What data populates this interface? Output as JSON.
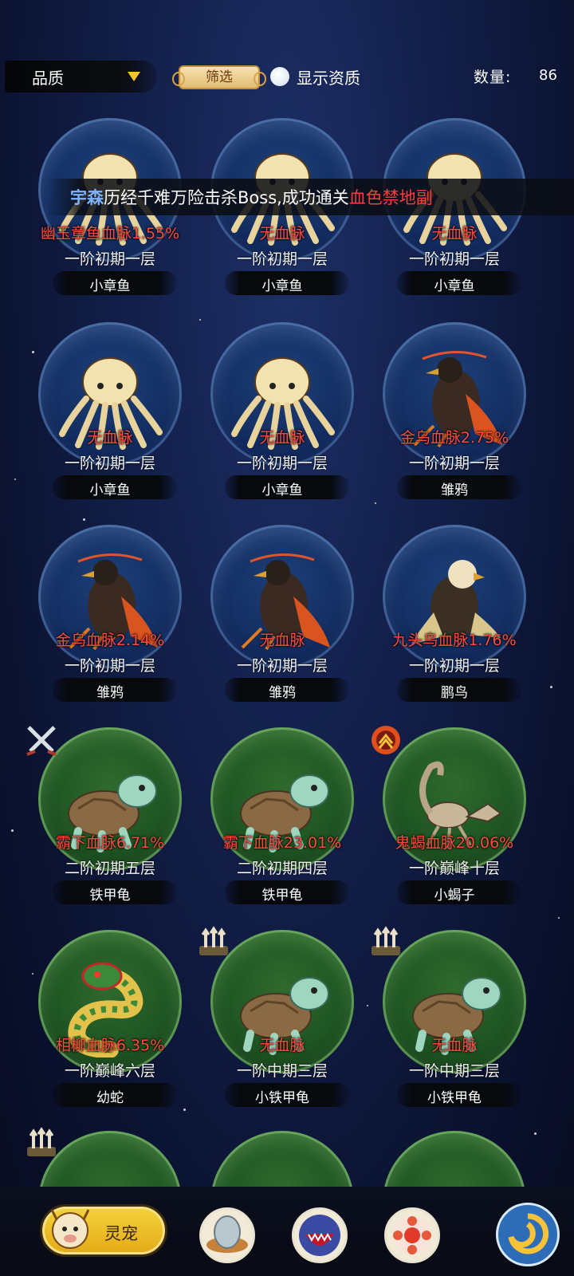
{
  "top_bar": {
    "quality_label": "品质",
    "filter_label": "筛选",
    "show_aptitude_label": "显示资质",
    "count_label": "数量:",
    "count_value": "86"
  },
  "broadcast": {
    "player": "宇森",
    "text": "历经千难万险击杀Boss,成功通关",
    "place": "血色禁地副"
  },
  "pets": [
    {
      "blood": "幽玉章鱼血脉1.55%",
      "stage": "一阶初期一层",
      "name": "小章鱼",
      "orb": "blue",
      "icon": "octopus-icon"
    },
    {
      "blood": "无血脉",
      "stage": "一阶初期一层",
      "name": "小章鱼",
      "orb": "blue",
      "icon": "octopus-icon"
    },
    {
      "blood": "无血脉",
      "stage": "一阶初期一层",
      "name": "小章鱼",
      "orb": "blue",
      "icon": "octopus-icon"
    },
    {
      "blood": "无血脉",
      "stage": "一阶初期一层",
      "name": "小章鱼",
      "orb": "blue",
      "icon": "octopus-icon"
    },
    {
      "blood": "无血脉",
      "stage": "一阶初期一层",
      "name": "小章鱼",
      "orb": "blue",
      "icon": "octopus-icon"
    },
    {
      "blood": "金乌血脉2.75%",
      "stage": "一阶初期一层",
      "name": "雏鸦",
      "orb": "blue",
      "icon": "crow-icon"
    },
    {
      "blood": "金乌血脉2.14%",
      "stage": "一阶初期一层",
      "name": "雏鸦",
      "orb": "blue",
      "icon": "crow-icon"
    },
    {
      "blood": "无血脉",
      "stage": "一阶初期一层",
      "name": "雏鸦",
      "orb": "blue",
      "icon": "crow-icon"
    },
    {
      "blood": "九头鸟血脉1.76%",
      "stage": "一阶初期一层",
      "name": "鹏鸟",
      "orb": "blue",
      "icon": "eagle-icon"
    },
    {
      "blood": "霸下血脉6.71%",
      "stage": "二阶初期五层",
      "name": "铁甲龟",
      "orb": "green",
      "icon": "turtle-icon",
      "badge": "crossed-swords-badge"
    },
    {
      "blood": "霸下血脉23.01%",
      "stage": "二阶初期四层",
      "name": "铁甲龟",
      "orb": "green",
      "icon": "turtle-icon"
    },
    {
      "blood": "鬼蝎血脉20.06%",
      "stage": "一阶巅峰十层",
      "name": "小蝎子",
      "orb": "green",
      "icon": "scorpion-icon",
      "badge": "fire-rank-badge"
    },
    {
      "blood": "相柳血脉6.35%",
      "stage": "一阶巅峰六层",
      "name": "幼蛇",
      "orb": "green",
      "icon": "snake-icon"
    },
    {
      "blood": "无血脉",
      "stage": "一阶中期三层",
      "name": "小铁甲龟",
      "orb": "green",
      "icon": "turtle-icon",
      "badge": "arrows-badge"
    },
    {
      "blood": "无血脉",
      "stage": "一阶中期三层",
      "name": "小铁甲龟",
      "orb": "green",
      "icon": "turtle-icon",
      "badge": "arrows-badge"
    },
    {
      "blood": "",
      "stage": "",
      "name": "",
      "orb": "green",
      "icon": "",
      "badge": "arrows-badge"
    },
    {
      "blood": "",
      "stage": "",
      "name": "",
      "orb": "green",
      "icon": ""
    },
    {
      "blood": "",
      "stage": "",
      "name": "",
      "orb": "green",
      "icon": ""
    }
  ],
  "bottom_nav": {
    "pet_tab_label": "灵宠",
    "items": [
      "egg-nest-icon",
      "monster-mouth-icon",
      "red-orb-icon",
      "swirl-icon"
    ]
  }
}
